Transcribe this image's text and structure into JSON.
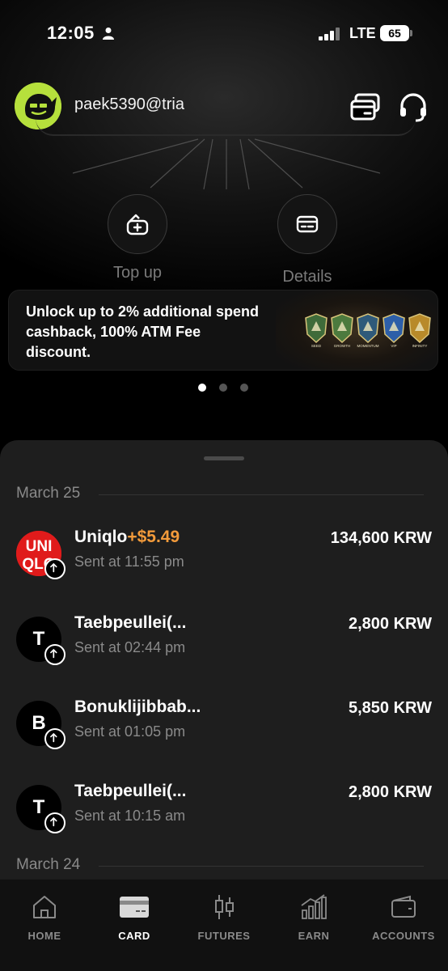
{
  "status_bar": {
    "time": "12:05",
    "network": "LTE",
    "battery": "65"
  },
  "header": {
    "username": "paek5390@tria"
  },
  "actions": {
    "top_up": "Top up",
    "details": "Details"
  },
  "promo": {
    "text": "Unlock up to 2% additional spend cashback, 100% ATM Fee discount.",
    "badges": [
      "SEED",
      "GROWTH",
      "MOMENTUM",
      "VIP",
      "INFINITY"
    ]
  },
  "carousel": {
    "count": 3,
    "active_index": 0
  },
  "transactions": {
    "groups": [
      {
        "date": "March 25",
        "items": [
          {
            "name": "Uniqlo",
            "cashback": "+$5.49",
            "subtitle": "Sent at 11:55 pm",
            "amount": "134,600 KRW",
            "logo_letter": ""
          },
          {
            "name": "Taebpeullei(...",
            "cashback": "",
            "subtitle": "Sent at 02:44 pm",
            "amount": "2,800 KRW",
            "logo_letter": "T"
          },
          {
            "name": "Bonuklijibbab...",
            "cashback": "",
            "subtitle": "Sent at 01:05 pm",
            "amount": "5,850 KRW",
            "logo_letter": "B"
          },
          {
            "name": "Taebpeullei(...",
            "cashback": "",
            "subtitle": "Sent at 10:15 am",
            "amount": "2,800 KRW",
            "logo_letter": "T"
          }
        ]
      },
      {
        "date": "March 24",
        "items": []
      }
    ]
  },
  "uniqlo_logo": {
    "line1": "UNI",
    "line2": "QLO"
  },
  "nav": {
    "items": [
      {
        "label": "HOME",
        "icon": "home-icon"
      },
      {
        "label": "CARD",
        "icon": "card-icon"
      },
      {
        "label": "FUTURES",
        "icon": "candlestick-icon"
      },
      {
        "label": "EARN",
        "icon": "bar-chart-icon"
      },
      {
        "label": "ACCOUNTS",
        "icon": "wallet-icon"
      }
    ],
    "active": "CARD"
  },
  "colors": {
    "accent_cashback": "#f39b3b",
    "avatar_green": "#b6e03c",
    "uniqlo_red": "#e01b1b"
  }
}
